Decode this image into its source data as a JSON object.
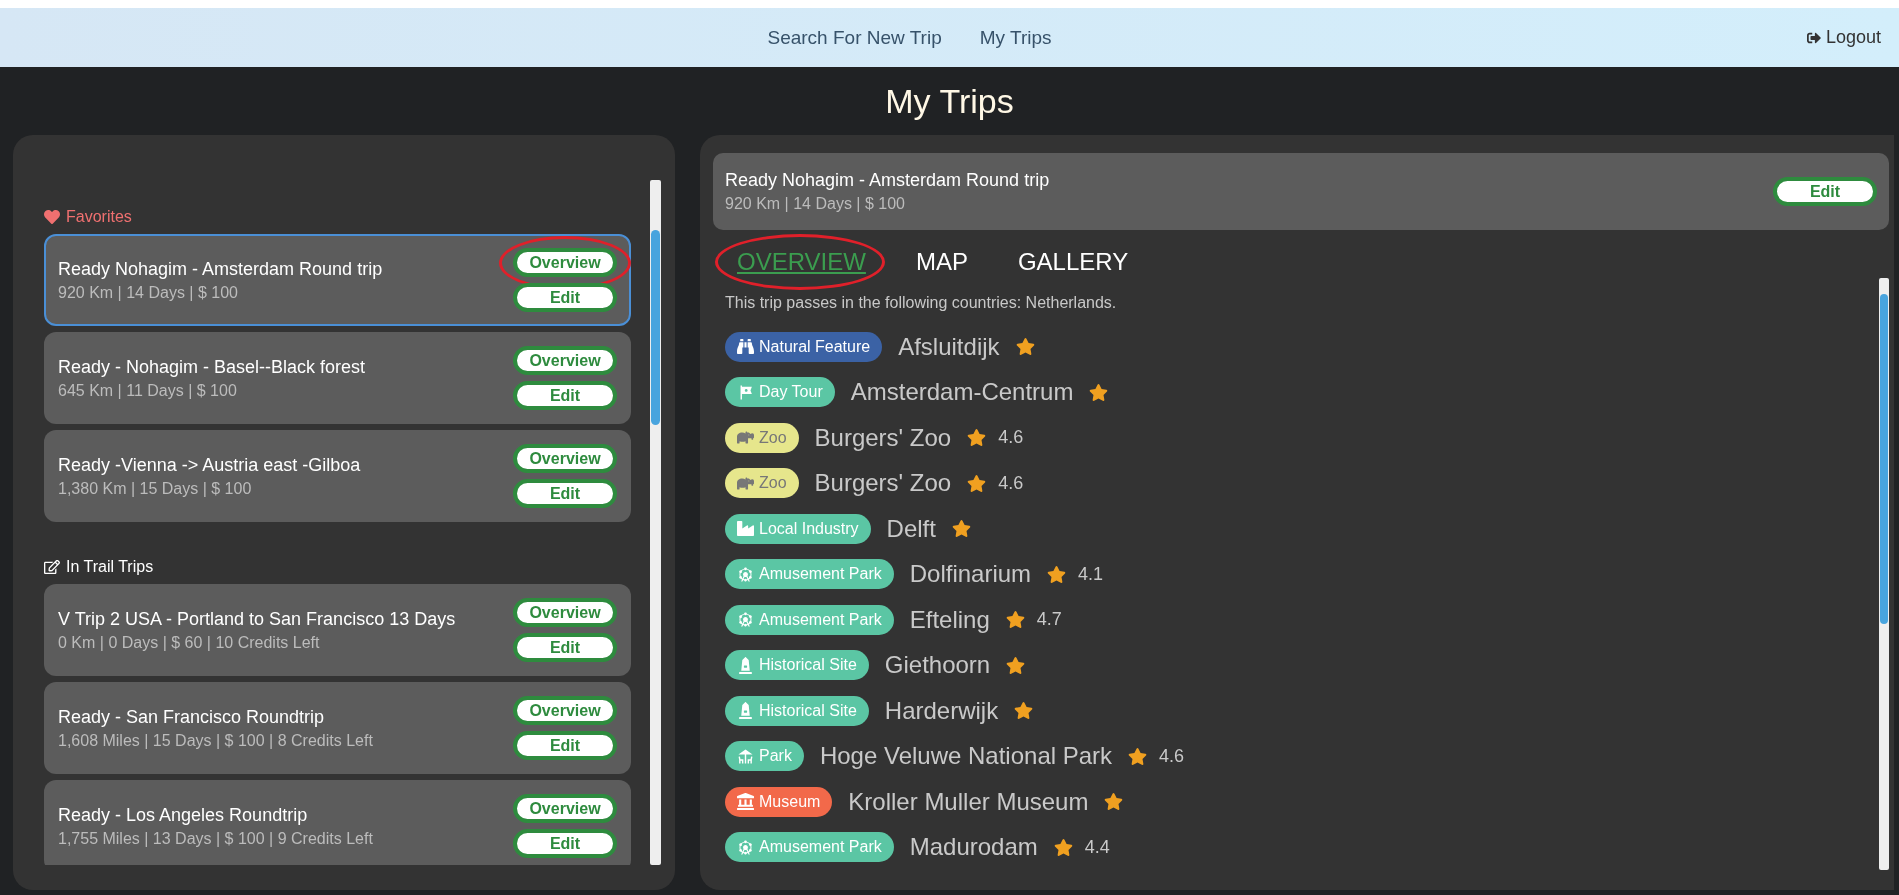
{
  "nav": {
    "links": [
      {
        "label": "Search For New Trip"
      },
      {
        "label": "My Trips"
      }
    ],
    "logout": "Logout"
  },
  "page_title": "My Trips",
  "sections": [
    {
      "kind": "favorites",
      "title": "Favorites",
      "trips": [
        {
          "title": "Ready Nohagim - Amsterdam Round trip",
          "details": "920 Km | 14 Days | $ 100",
          "selected": true,
          "buttons": [
            {
              "label": "Overview",
              "circled": true
            },
            {
              "label": "Edit",
              "circled": false
            }
          ]
        },
        {
          "title": "Ready - Nohagim - Basel--Black forest",
          "details": "645 Km | 11 Days | $ 100",
          "selected": false,
          "buttons": [
            {
              "label": "Overview",
              "circled": false
            },
            {
              "label": "Edit",
              "circled": false
            }
          ]
        },
        {
          "title": "Ready -Vienna -> Austria east -Gilboa",
          "details": "1,380 Km | 15 Days | $ 100",
          "selected": false,
          "buttons": [
            {
              "label": "Overview",
              "circled": false
            },
            {
              "label": "Edit",
              "circled": false
            }
          ]
        }
      ]
    },
    {
      "kind": "in_trail",
      "title": "In Trail Trips",
      "trips": [
        {
          "title": "V Trip 2 USA - Portland to San Francisco 13 Days",
          "details": "0 Km | 0 Days | $ 60 | 10 Credits Left",
          "selected": false,
          "buttons": [
            {
              "label": "Overview",
              "circled": false
            },
            {
              "label": "Edit",
              "circled": false
            }
          ]
        },
        {
          "title": "Ready - San Francisco Roundtrip",
          "details": "1,608 Miles | 15 Days | $ 100 | 8 Credits Left",
          "selected": false,
          "buttons": [
            {
              "label": "Overview",
              "circled": false
            },
            {
              "label": "Edit",
              "circled": false
            }
          ]
        },
        {
          "title": "Ready - Los Angeles Roundtrip",
          "details": "1,755 Miles | 13 Days | $ 100 | 9 Credits Left",
          "selected": false,
          "buttons": [
            {
              "label": "Overview",
              "circled": false
            },
            {
              "label": "Edit",
              "circled": false
            }
          ]
        }
      ]
    }
  ],
  "detail": {
    "title": "Ready Nohagim - Amsterdam Round trip",
    "details": "920 Km | 14 Days | $ 100",
    "edit_button": "Edit",
    "tabs": [
      {
        "label": "OVERVIEW",
        "selected": true,
        "circled": true
      },
      {
        "label": "MAP",
        "selected": false,
        "circled": false
      },
      {
        "label": "GALLERY",
        "selected": false,
        "circled": false
      }
    ],
    "countries_text": "This trip passes in the following countries: Netherlands.",
    "attractions": [
      {
        "category": "Natural Feature",
        "kind": "natural",
        "color": "#3b62a5",
        "name": "Afsluitdijk"
      },
      {
        "category": "Day Tour",
        "kind": "tour",
        "color": "#5bc6a4",
        "name": "Amsterdam-Centrum"
      },
      {
        "category": "Zoo",
        "kind": "zoo",
        "color": "#e6e68c",
        "name": "Burgers' Zoo",
        "rating": "4.6"
      },
      {
        "category": "Zoo",
        "kind": "zoo",
        "color": "#e6e68c",
        "name": "Burgers' Zoo",
        "rating": "4.6"
      },
      {
        "category": "Local Industry",
        "kind": "industry",
        "color": "#5bc6a4",
        "name": "Delft"
      },
      {
        "category": "Amusement Park",
        "kind": "amusement",
        "color": "#5bc6a4",
        "name": "Dolfinarium",
        "rating": "4.1"
      },
      {
        "category": "Amusement Park",
        "kind": "amusement",
        "color": "#5bc6a4",
        "name": "Efteling",
        "rating": "4.7"
      },
      {
        "category": "Historical Site",
        "kind": "historical",
        "color": "#5bc6a4",
        "name": "Giethoorn"
      },
      {
        "category": "Historical Site",
        "kind": "historical",
        "color": "#5bc6a4",
        "name": "Harderwijk"
      },
      {
        "category": "Park",
        "kind": "park",
        "color": "#5bc6a4",
        "name": "Hoge Veluwe National Park",
        "rating": "4.6"
      },
      {
        "category": "Museum",
        "kind": "museum",
        "color": "#f2694a",
        "name": "Kroller Muller Museum"
      },
      {
        "category": "Amusement Park",
        "kind": "amusement",
        "color": "#5bc6a4",
        "name": "Madurodam",
        "rating": "4.4"
      }
    ]
  }
}
